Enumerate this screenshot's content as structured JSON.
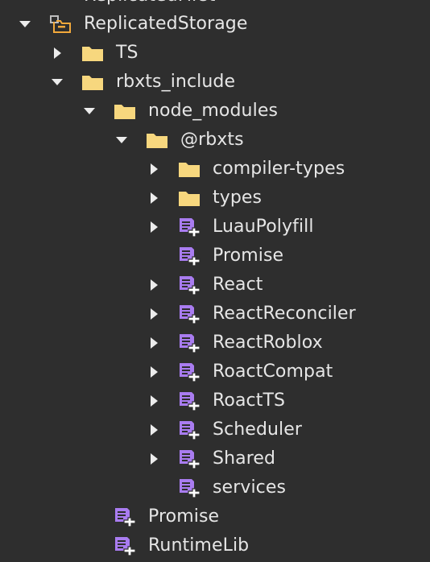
{
  "explorer": {
    "partial_top_item": "ReplicatedFirst",
    "items": [
      {
        "label": "ReplicatedStorage",
        "icon": "replicated-storage-icon",
        "expanded": true
      },
      {
        "label": "TS",
        "icon": "folder-icon",
        "expanded": false
      },
      {
        "label": "rbxts_include",
        "icon": "folder-icon",
        "expanded": true
      },
      {
        "label": "node_modules",
        "icon": "folder-icon",
        "expanded": true
      },
      {
        "label": "@rbxts",
        "icon": "folder-icon",
        "expanded": true
      },
      {
        "label": "compiler-types",
        "icon": "folder-icon",
        "expanded": false
      },
      {
        "label": "types",
        "icon": "folder-icon",
        "expanded": false
      },
      {
        "label": "LuauPolyfill",
        "icon": "module-script-icon",
        "expanded": false
      },
      {
        "label": "Promise",
        "icon": "module-script-icon"
      },
      {
        "label": "React",
        "icon": "module-script-icon",
        "expanded": false
      },
      {
        "label": "ReactReconciler",
        "icon": "module-script-icon",
        "expanded": false
      },
      {
        "label": "ReactRoblox",
        "icon": "module-script-icon",
        "expanded": false
      },
      {
        "label": "RoactCompat",
        "icon": "module-script-icon",
        "expanded": false
      },
      {
        "label": "RoactTS",
        "icon": "module-script-icon",
        "expanded": false
      },
      {
        "label": "Scheduler",
        "icon": "module-script-icon",
        "expanded": false
      },
      {
        "label": "Shared",
        "icon": "module-script-icon",
        "expanded": false
      },
      {
        "label": "services",
        "icon": "module-script-icon"
      },
      {
        "label": "Promise",
        "icon": "module-script-icon"
      },
      {
        "label": "RuntimeLib",
        "icon": "module-script-icon"
      }
    ]
  },
  "colors": {
    "background": "#2e2e2e",
    "text": "#e6e6e6",
    "folder": "#f7d77e",
    "module": "#a97cf0",
    "caret": "#ececec"
  }
}
